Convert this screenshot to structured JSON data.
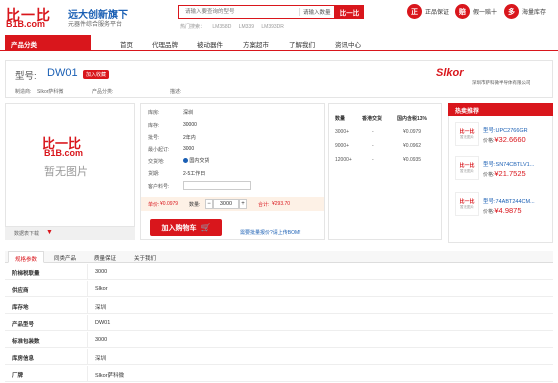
{
  "header": {
    "logo_cn": "比一比",
    "logo_en": "B1B.com",
    "slogan": "远大创新旗下",
    "subslogan": "元器件综合服务平台",
    "search_placeholder": "请输入要查询的型号",
    "search_qty": "请输入数量",
    "search_button": "比一比",
    "hot_label": "热门搜索：",
    "hot_terms": [
      "LM358D",
      "LM339",
      "LM393DR"
    ],
    "promises": [
      {
        "badge": "正",
        "label": "正品保证"
      },
      {
        "badge": "赔",
        "label": "假一赔十"
      },
      {
        "badge": "多",
        "label": "海量库存"
      }
    ]
  },
  "nav": {
    "category_label": "产品分类",
    "items": [
      "首页",
      "代理品牌",
      "被动器件",
      "方案超市",
      "了解我们",
      "资讯中心"
    ]
  },
  "product": {
    "model_label": "型号:",
    "model": "DW01",
    "tag": "加入收藏",
    "manufacturer_label": "制造商:",
    "manufacturer": "Slkor萨科微",
    "category_label": "产品分类:",
    "description_label": "描述:",
    "brand_logo": "Slkor",
    "brand_full": "深圳市萨科微半导体有限公司"
  },
  "image": {
    "logo_cn": "比一比",
    "logo_en": "B1B.com",
    "no_image": "暂无图片",
    "datasheet": "数据表下载"
  },
  "info": {
    "rows": [
      {
        "label": "库房:",
        "value": "深圳"
      },
      {
        "label": "库存:",
        "value": "30000"
      },
      {
        "label": "批号:",
        "value": "2年内"
      },
      {
        "label": "最小起订:",
        "value": "3000"
      },
      {
        "label": "交货地:",
        "value": "国内交货"
      },
      {
        "label": "货期:",
        "value": "2-5工作日"
      },
      {
        "label": "客户料号:",
        "value": ""
      }
    ],
    "unit_price_label": "单价:",
    "unit_price": "¥0.0979",
    "qty_label": "数量:",
    "qty": "3000",
    "minus": "−",
    "plus": "+",
    "total_label": "合计:",
    "total": "¥293.70",
    "cart_button": "加入购物车",
    "bulk_link": "需要批量报价?请上传BOM!"
  },
  "price_table": {
    "headers": [
      "数量",
      "香港交货",
      "国内含税13%"
    ],
    "rows": [
      [
        "3000+",
        "-",
        "¥0.0979"
      ],
      [
        "9000+",
        "-",
        "¥0.0962"
      ],
      [
        "12000+",
        "-",
        "¥0.0935"
      ]
    ]
  },
  "hot_products": {
    "title": "热卖推荐",
    "model_label": "型号:",
    "price_label": "价格:",
    "items": [
      {
        "model": "UPC2766GR",
        "price": "¥32.6660"
      },
      {
        "model": "SN74CBTLV1...",
        "price": "¥21.7525"
      },
      {
        "model": "74ABT244CM...",
        "price": "¥4.9875"
      }
    ]
  },
  "tabs": [
    "规格参数",
    "同类产品",
    "质量保证",
    "关于我们"
  ],
  "specs": [
    {
      "key": "阶梯税联量",
      "value": "3000"
    },
    {
      "key": "供应商",
      "value": "Slkor"
    },
    {
      "key": "库存地",
      "value": "深圳"
    },
    {
      "key": "产品型号",
      "value": "DW01"
    },
    {
      "key": "标准包装数",
      "value": "3000"
    },
    {
      "key": "库房信息",
      "value": "深圳"
    },
    {
      "key": "厂牌",
      "value": "Slkor萨科微"
    }
  ]
}
